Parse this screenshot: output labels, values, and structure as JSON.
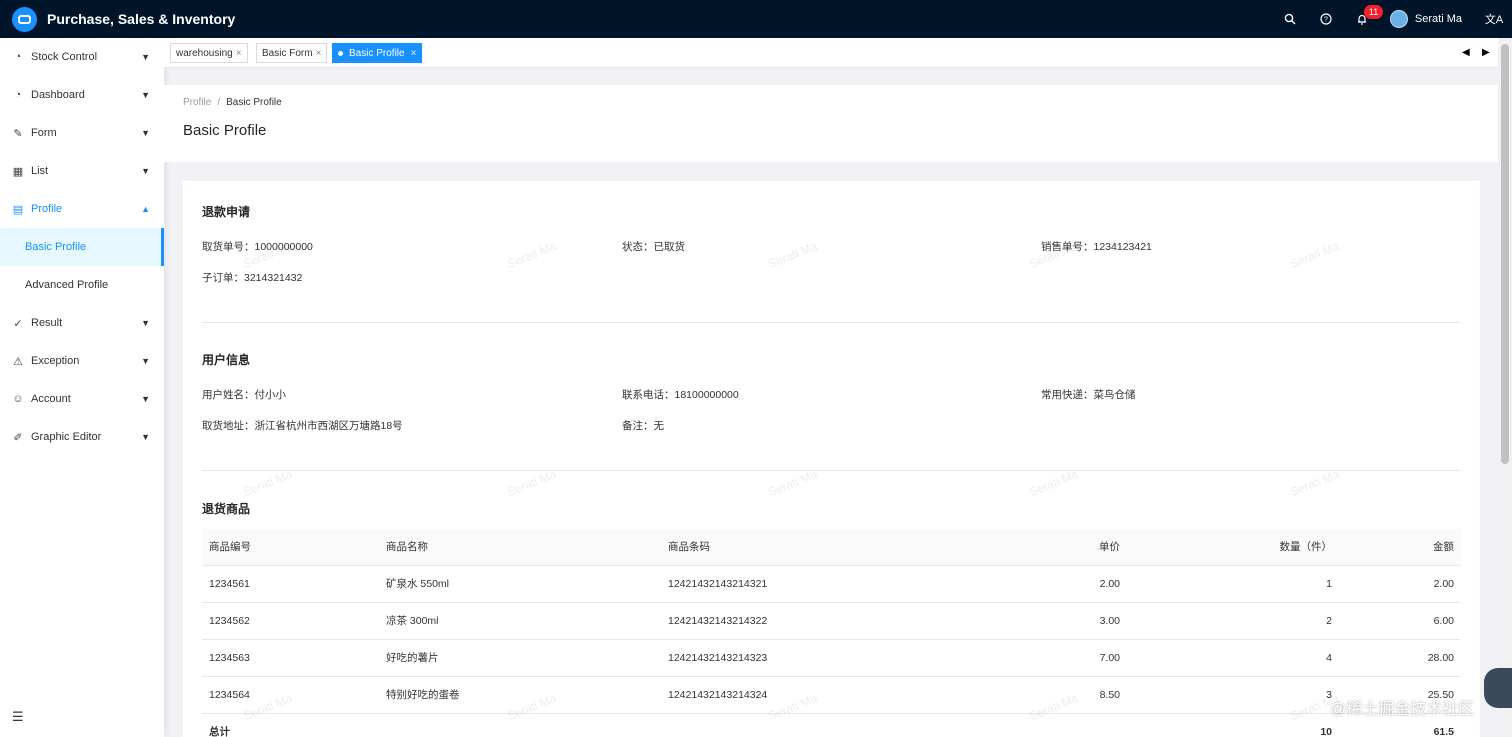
{
  "app": {
    "title": "Purchase, Sales & Inventory"
  },
  "header": {
    "notification_count": "11",
    "user_name": "Serati Ma",
    "icons": [
      "search-icon",
      "help-icon",
      "bell-icon",
      "translate-icon"
    ]
  },
  "sidebar": {
    "items": [
      {
        "label": "Stock Control",
        "icon": "dashboard-icon"
      },
      {
        "label": "Dashboard",
        "icon": "dashboard-icon"
      },
      {
        "label": "Form",
        "icon": "form-icon"
      },
      {
        "label": "List",
        "icon": "table-icon"
      },
      {
        "label": "Profile",
        "icon": "profile-icon"
      },
      {
        "label": "Result",
        "icon": "check-circle-icon"
      },
      {
        "label": "Exception",
        "icon": "warning-icon"
      },
      {
        "label": "Account",
        "icon": "user-icon"
      },
      {
        "label": "Graphic Editor",
        "icon": "highlight-icon"
      }
    ],
    "profile_sub": [
      "Basic Profile",
      "Advanced Profile"
    ]
  },
  "tabs": [
    {
      "label": "warehousing"
    },
    {
      "label": "Basic Form"
    },
    {
      "label": "Basic Profile",
      "active": true
    }
  ],
  "breadcrumb": {
    "parent": "Profile",
    "current": "Basic Profile"
  },
  "page_title": "Basic Profile",
  "refund": {
    "title": "退款申请",
    "pickup_no": "取货单号：1000000000",
    "status": "状态：已取货",
    "sales_no": "销售单号：1234123421",
    "sub_order": "子订单：3214321432"
  },
  "user_info": {
    "title": "用户信息",
    "name": "用户姓名：付小小",
    "phone": "联系电话：18100000000",
    "express": "常用快递：菜鸟仓储",
    "address": "取货地址：浙江省杭州市西湖区万塘路18号",
    "remark": "备注：无"
  },
  "goods": {
    "title": "退货商品",
    "columns": [
      "商品编号",
      "商品名称",
      "商品条码",
      "单价",
      "数量（件）",
      "金额"
    ],
    "rows": [
      [
        "1234561",
        "矿泉水 550ml",
        "12421432143214321",
        "2.00",
        "1",
        "2.00"
      ],
      [
        "1234562",
        "凉茶 300ml",
        "12421432143214322",
        "3.00",
        "2",
        "6.00"
      ],
      [
        "1234563",
        "好吃的薯片",
        "12421432143214323",
        "7.00",
        "4",
        "28.00"
      ],
      [
        "1234564",
        "特别好吃的蛋卷",
        "12421432143214324",
        "8.50",
        "3",
        "25.50"
      ]
    ],
    "total": {
      "label": "总计",
      "qty": "10",
      "amount": "61.5"
    }
  },
  "watermark": "Serati Ma",
  "site_mark": "@稀土掘金技术社区",
  "colors": {
    "header_bg": "#001529",
    "accent": "#1890ff"
  }
}
